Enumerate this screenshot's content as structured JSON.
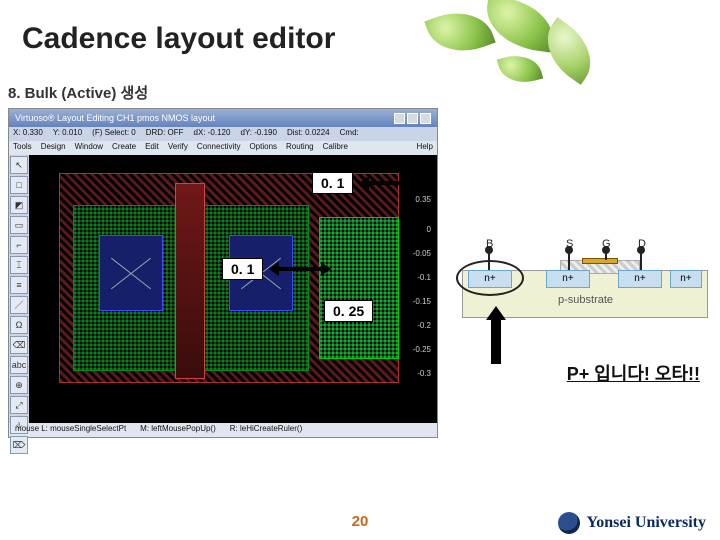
{
  "page": {
    "title": "Cadence layout editor",
    "subtitle": "8. Bulk (Active) 생성",
    "page_number": "20",
    "university": "Yonsei University"
  },
  "cadence": {
    "window_title": "Virtuoso® Layout Editing  CH1 pmos NMOS layout",
    "status_fields": [
      "X: 0.330",
      "Y: 0.010",
      "(F) Select: 0",
      "DRD: OFF",
      "dX: -0.120",
      "dY: -0.190",
      "Dist: 0.0224",
      "Cmd:"
    ],
    "menu": [
      "Tools",
      "Design",
      "Window",
      "Create",
      "Edit",
      "Verify",
      "Connectivity",
      "Options",
      "Routing",
      "Calibre"
    ],
    "menu_help": "Help",
    "toolbar_icons": [
      "↖",
      "□",
      "◩",
      "▭",
      "⌐",
      "⌶",
      "≡",
      "／",
      "Ω",
      "⌫",
      "abc",
      "⊕",
      "⤢",
      "⎀",
      "⌦"
    ],
    "bottom_hints": [
      "mouse L: mouseSingleSelectPt",
      "M: leftMousePopUp()",
      "R: leHiCreateRuler()"
    ],
    "ruler_ticks": [
      "0.35",
      "0",
      "-0.05",
      "-0.1",
      "-0.15",
      "-0.2",
      "-0.25",
      "-0.3"
    ]
  },
  "annotations": {
    "dim_top": "0. 1",
    "dim_mid": "0. 1",
    "dim_side": "0. 25",
    "note": "P+ 입니다! 오타!!"
  },
  "cross_section": {
    "terminals": {
      "B": "B",
      "S": "S",
      "G": "G",
      "D": "D"
    },
    "diffusion_label": "n+",
    "substrate_label": "p-substrate"
  }
}
